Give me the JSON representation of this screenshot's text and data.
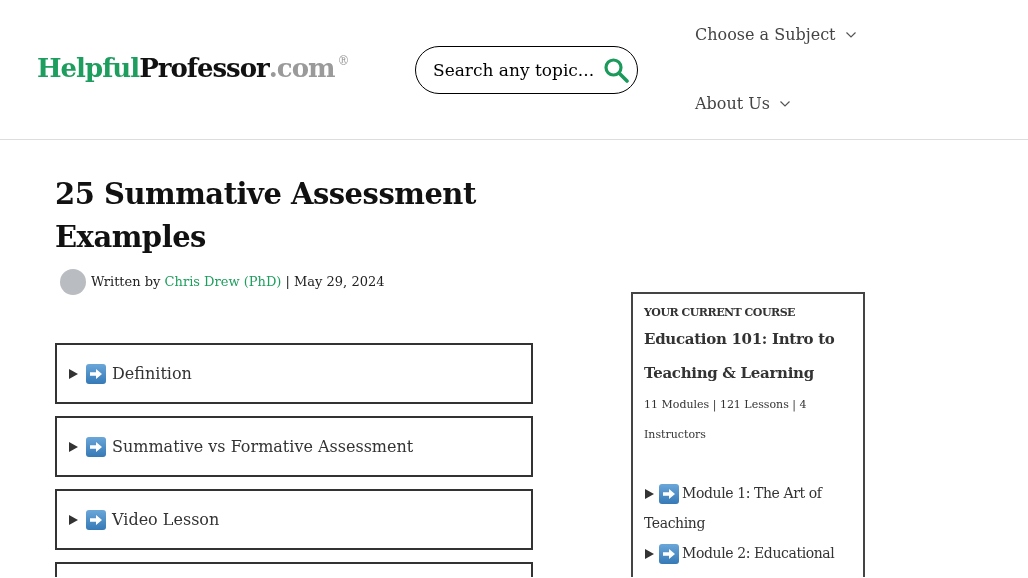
{
  "header": {
    "logo": {
      "brand_first": "Helpful",
      "brand_second": "Professor",
      "domain": ".com",
      "registered_mark": "®"
    },
    "search": {
      "placeholder": "Search any topic..."
    },
    "nav": [
      {
        "label": "Choose a Subject"
      },
      {
        "label": "About Us"
      }
    ]
  },
  "article": {
    "title": "25 Summative Assessment Examples",
    "byline": {
      "prefix": "Written by",
      "author": "Chris Drew (PhD)",
      "separator": "|",
      "date": "May 29, 2024"
    },
    "sections": [
      {
        "title": "Definition",
        "expanded": false
      },
      {
        "title": "Summative vs Formative Assessment",
        "expanded": false
      },
      {
        "title": "Video Lesson",
        "expanded": false
      }
    ]
  },
  "sidebar": {
    "eyebrow": "YOUR CURRENT COURSE",
    "course_title": "Education 101: Intro to Teaching & Learning",
    "meta": "11 Modules | 121 Lessons | 4 Instructors",
    "modules": [
      {
        "title": "Module 1: The Art of Teaching",
        "expanded": false
      },
      {
        "title": "Module 2: Educational",
        "expanded": false
      }
    ]
  }
}
